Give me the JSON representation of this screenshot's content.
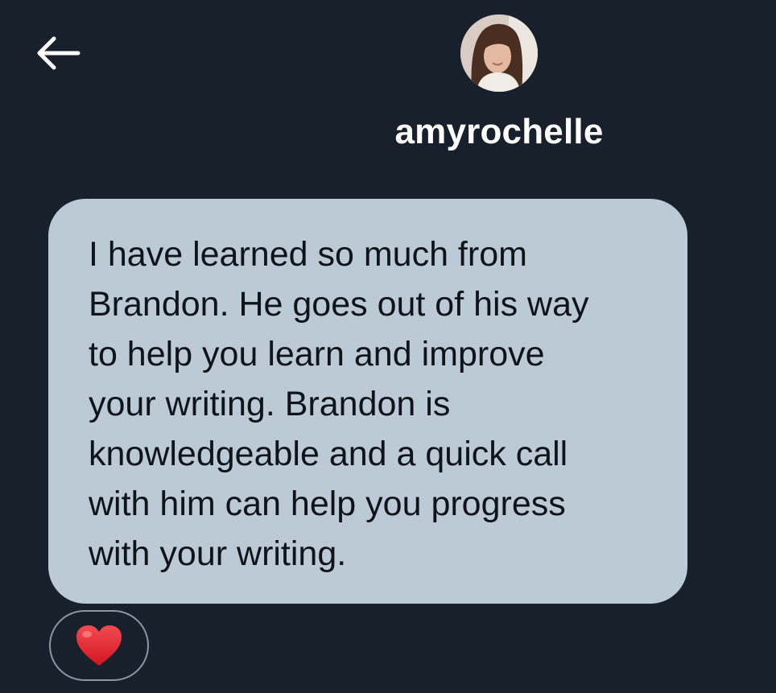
{
  "header": {
    "back_icon": "arrow-left-icon",
    "username": "amyrochelle"
  },
  "message": {
    "lines": [
      "I have learned so much from",
      "Brandon. He goes out of his way",
      "to help you learn and improve",
      "your writing. Brandon is",
      "knowledgeable and a quick call",
      "with him can help you progress",
      "with your writing."
    ]
  },
  "reaction": {
    "icon": "red-heart-icon",
    "color": "#e0202b"
  },
  "colors": {
    "background": "#18202c",
    "bubble": "#bccad6",
    "text": "#0f141a",
    "username": "#ffffff"
  }
}
